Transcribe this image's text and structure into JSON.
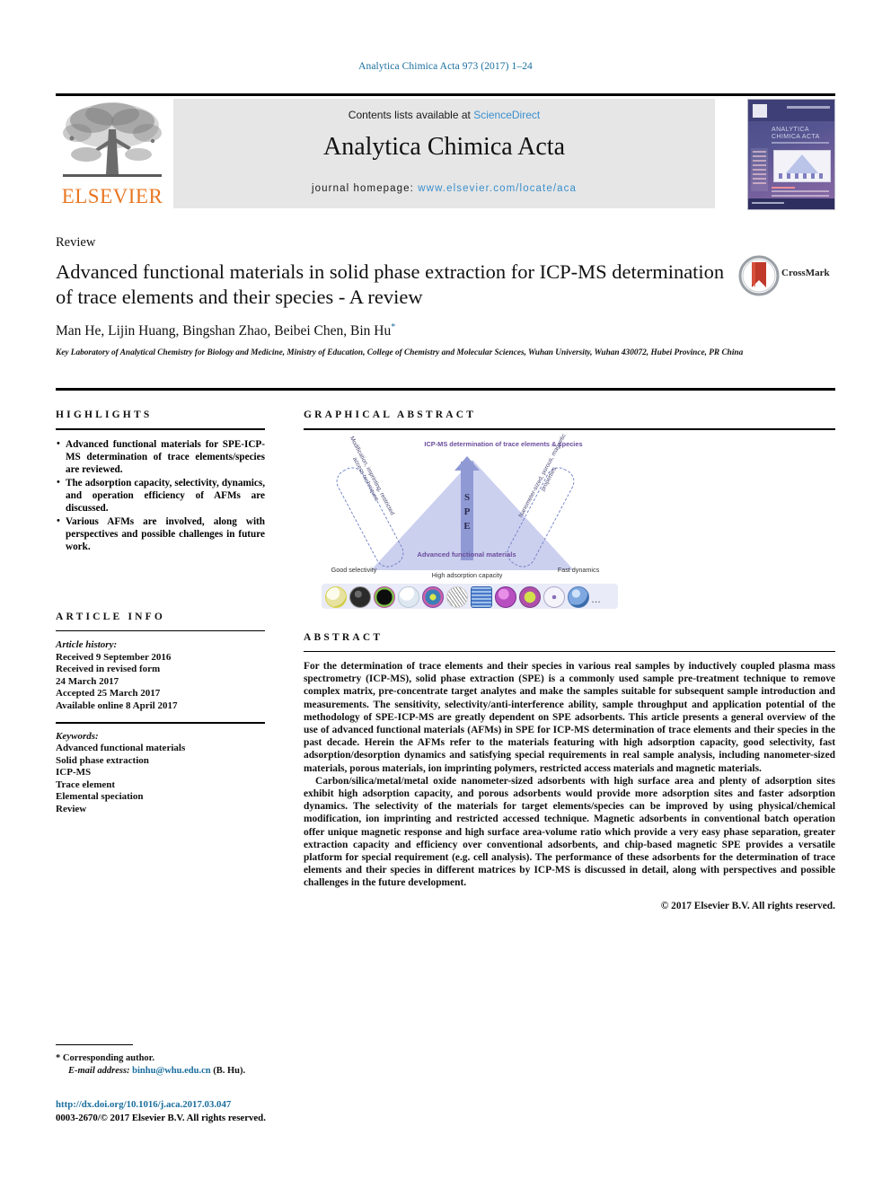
{
  "running_head": "Analytica Chimica Acta 973 (2017) 1–24",
  "masthead": {
    "contents_prefix": "Contents lists available at ",
    "sciencedirect": "ScienceDirect",
    "journal_title": "Analytica Chimica Acta",
    "homepage_prefix": "journal homepage: ",
    "homepage_url": "www.elsevier.com/locate/aca",
    "publisher": "ELSEVIER",
    "cover_journal_name": "ANALYTICA CHIMICA ACTA"
  },
  "title_block": {
    "doctype": "Review",
    "title": "Advanced functional materials in solid phase extraction for ICP-MS determination of trace elements and their species - A review",
    "authors": "Man He, Lijin Huang, Bingshan Zhao, Beibei Chen, Bin Hu",
    "corresponding_marker": "*",
    "affiliation": "Key Laboratory of Analytical Chemistry for Biology and Medicine, Ministry of Education, College of Chemistry and Molecular Sciences, Wuhan University, Wuhan 430072, Hubei Province, PR China",
    "crossmark_label": "CrossMark"
  },
  "highlights": {
    "heading": "HIGHLIGHTS",
    "items": [
      "Advanced functional materials for SPE-ICP-MS determination of trace elements/species are reviewed.",
      "The adsorption capacity, selectivity, dynamics, and operation efficiency of AFMs are discussed.",
      "Various AFMs are involved, along with perspectives and possible challenges in future work."
    ]
  },
  "article_info": {
    "heading": "ARTICLE INFO",
    "history_label": "Article history:",
    "history": [
      "Received 9 September 2016",
      "Received in revised form",
      "24 March 2017",
      "Accepted 25 March 2017",
      "Available online 8 April 2017"
    ],
    "keywords_label": "Keywords:",
    "keywords": [
      "Advanced functional materials",
      "Solid phase extraction",
      "ICP-MS",
      "Trace element",
      "Elemental speciation",
      "Review"
    ]
  },
  "graphical_abstract": {
    "heading": "GRAPHICAL ABSTRACT",
    "top_label": "ICP-MS determination of trace elements & species",
    "arrow_label": "SPE",
    "center_label": "Advanced functional materials",
    "left_dashed_label": "Modification, imprinting, restricted access techniques",
    "right_dashed_label": "Nanometer-sized, porous, magnetic properties",
    "corner_left": "Good selectivity",
    "corner_mid": "High adsorption capacity",
    "corner_right": "Fast dynamics",
    "ellipsis": "…",
    "colors": {
      "triangle_fill": "#ccd0ef",
      "arrow": "#8f9ad4",
      "label_purple": "#6a4c9c",
      "dashed_border": "#6f82c4",
      "strip_bg": "#e9ebf8"
    },
    "nanoparticles": [
      {
        "name": "fullerene-cage",
        "color": "#f4f2e2",
        "ring": "#d8d24a"
      },
      {
        "name": "mesoporous-carbon",
        "color": "#4a4a4a",
        "ring": "#8a8a8a"
      },
      {
        "name": "core-shell-green",
        "color": "#101010",
        "ring": "#7fc24a"
      },
      {
        "name": "nanosheet-pale",
        "color": "#eef2f6",
        "ring": "#b9c9d8"
      },
      {
        "name": "multilayer-onion",
        "color": "#3c7fb8",
        "ring": "#cf5fa8"
      },
      {
        "name": "honeycomb-framework",
        "color": "#f7f7f7",
        "ring": "#cfcfcf"
      },
      {
        "name": "cubic-mof",
        "color": "#5b8fd6",
        "ring": "#2f5fa8"
      },
      {
        "name": "magnetic-sphere",
        "color": "#b84fc0",
        "ring": "#7b2f8c"
      },
      {
        "name": "imprinted-polymer",
        "color": "#d2e04a",
        "ring": "#b04fa8"
      },
      {
        "name": "spiky-nanostar",
        "color": "#f0f0f5",
        "ring": "#b0a8c8"
      },
      {
        "name": "core-shell-blue",
        "color": "#7fa8e0",
        "ring": "#4a78b8"
      }
    ]
  },
  "abstract": {
    "heading": "ABSTRACT",
    "paragraphs": [
      "For the determination of trace elements and their species in various real samples by inductively coupled plasma mass spectrometry (ICP-MS), solid phase extraction (SPE) is a commonly used sample pre-treatment technique to remove complex matrix, pre-concentrate target analytes and make the samples suitable for subsequent sample introduction and measurements. The sensitivity, selectivity/anti-interference ability, sample throughput and application potential of the methodology of SPE-ICP-MS are greatly dependent on SPE adsorbents. This article presents a general overview of the use of advanced functional materials (AFMs) in SPE for ICP-MS determination of trace elements and their species in the past decade. Herein the AFMs refer to the materials featuring with high adsorption capacity, good selectivity, fast adsorption/desorption dynamics and satisfying special requirements in real sample analysis, including nanometer-sized materials, porous materials, ion imprinting polymers, restricted access materials and magnetic materials.",
      "Carbon/silica/metal/metal oxide nanometer-sized adsorbents with high surface area and plenty of adsorption sites exhibit high adsorption capacity, and porous adsorbents would provide more adsorption sites and faster adsorption dynamics. The selectivity of the materials for target elements/species can be improved by using physical/chemical modification, ion imprinting and restricted accessed technique. Magnetic adsorbents in conventional batch operation offer unique magnetic response and high surface area-volume ratio which provide a very easy phase separation, greater extraction capacity and efficiency over conventional adsorbents, and chip-based magnetic SPE provides a versatile platform for special requirement (e.g. cell analysis). The performance of these adsorbents for the determination of trace elements and their species in different matrices by ICP-MS is discussed in detail, along with perspectives and possible challenges in the future development."
    ],
    "copyright": "© 2017 Elsevier B.V. All rights reserved."
  },
  "footer": {
    "corresponding_marker": "*",
    "corresponding_text": "Corresponding author.",
    "email_label": "E-mail address:",
    "email": "binhu@whu.edu.cn",
    "email_owner": "(B. Hu).",
    "doi_url": "http://dx.doi.org/10.1016/j.aca.2017.03.047",
    "issn_line": "0003-2670/© 2017 Elsevier B.V. All rights reserved."
  }
}
